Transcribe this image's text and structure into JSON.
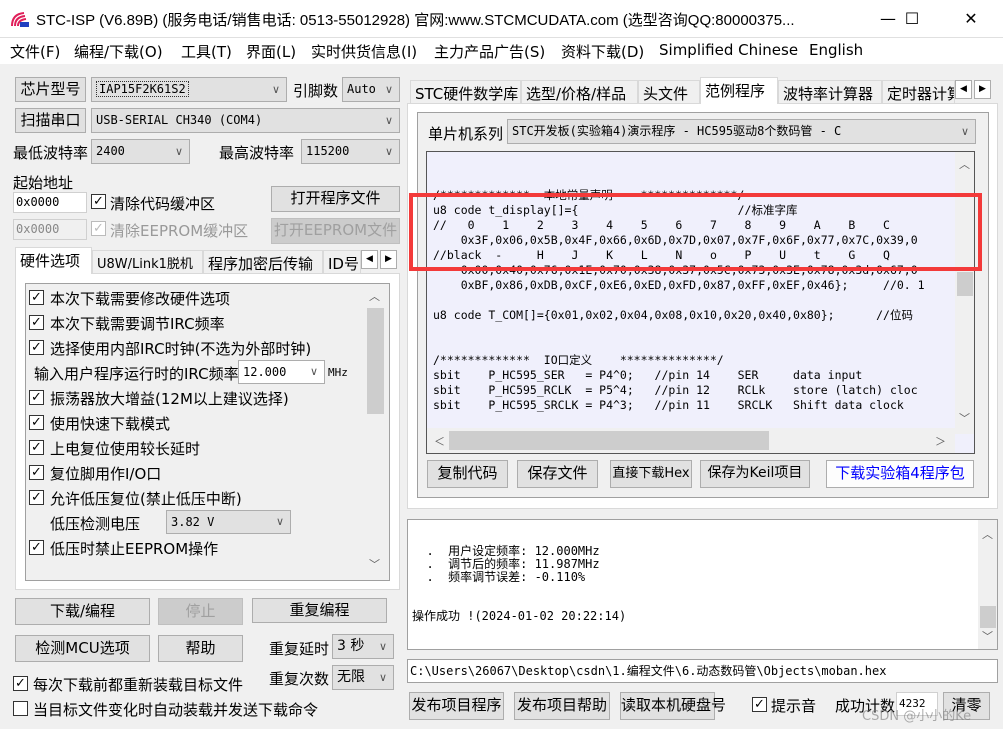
{
  "window": {
    "title": "STC-ISP (V6.89B) (服务电话/销售电话: 0513-55012928) 官网:www.STCMCUDATA.com  (选型咨询QQ:80000375...",
    "controls": {
      "minimize": "—",
      "maximize": "☐",
      "close": "✕"
    }
  },
  "menu": [
    "文件(F)",
    "编程/下载(O)",
    "工具(T)",
    "界面(L)",
    "实时供货信息(I)",
    "主力产品广告(S)",
    "资料下载(D)",
    "Simplified Chinese",
    "English"
  ],
  "left": {
    "chip_type_button": "芯片型号",
    "chip_type_value": "IAP15F2K61S2",
    "pin_label": "引脚数",
    "pin_value": "Auto",
    "scan_port_button": "扫描串口",
    "port_value": "USB-SERIAL CH340 (COM4)",
    "min_baud_label": "最低波特率",
    "min_baud_value": "2400",
    "max_baud_label": "最高波特率",
    "max_baud_value": "115200",
    "start_addr_label": "起始地址",
    "code_addr": "0x0000",
    "clear_code_label": "清除代码缓冲区",
    "clear_code_checked": true,
    "open_program_button": "打开程序文件",
    "eeprom_addr": "0x0000",
    "clear_eeprom_label": "清除EEPROM缓冲区",
    "clear_eeprom_checked": true,
    "open_eeprom_button": "打开EEPROM文件",
    "tabs": [
      "硬件选项",
      "U8W/Link1脱机",
      "程序加密后传输",
      "ID号"
    ],
    "active_tab": 0,
    "options": [
      {
        "label": "本次下载需要修改硬件选项",
        "checked": true
      },
      {
        "label": "本次下载需要调节IRC频率",
        "checked": true
      },
      {
        "label": "选择使用内部IRC时钟(不选为外部时钟)",
        "checked": true
      }
    ],
    "irc_label": "输入用户程序运行时的IRC频率",
    "irc_value": "12.000",
    "irc_unit": "MHz",
    "options2": [
      {
        "label": "振荡器放大增益(12M以上建议选择)",
        "checked": true
      },
      {
        "label": "使用快速下载模式",
        "checked": true
      },
      {
        "label": "上电复位使用较长延时",
        "checked": true
      },
      {
        "label": "复位脚用作I/O口",
        "checked": true
      },
      {
        "label": "允许低压复位(禁止低压中断)",
        "checked": true
      }
    ],
    "low_voltage_label": "低压检测电压",
    "low_voltage_value": "3.82 V",
    "eeprom_protect": {
      "label": "低压时禁止EEPROM操作",
      "checked": true
    },
    "download_button": "下载/编程",
    "stop_button": "停止",
    "repeat_program_button": "重复编程",
    "detect_mcu_button": "检测MCU选项",
    "help_button": "帮助",
    "repeat_delay_label": "重复延时",
    "repeat_delay_value": "3 秒",
    "repeat_count_label": "重复次数",
    "repeat_count_value": "无限",
    "reload_label": "每次下载前都重新装载目标文件",
    "reload_checked": true,
    "auto_send_label": "当目标文件变化时自动装载并发送下载命令",
    "auto_send_checked": false
  },
  "right": {
    "tabs": [
      "STC硬件数学库",
      "选型/价格/样品",
      "头文件",
      "范例程序",
      "波特率计算器",
      "定时器计算"
    ],
    "active_tab": 3,
    "series_label": "单片机系列",
    "series_value": "STC开发板(实验箱4)演示程序 - HC595驱动8个数码管 - C",
    "code_lines": [
      "",
      "",
      "/*************  本地常量声明    **************/",
      "u8 code t_display[]={                       //标准字库",
      "//   0    1    2    3    4    5    6    7    8    9    A    B    C",
      "    0x3F,0x06,0x5B,0x4F,0x66,0x6D,0x7D,0x07,0x7F,0x6F,0x77,0x7C,0x39,0",
      "//black  -     H    J    K    L    N    o    P    U    t    G    Q",
      "    0x00,0x40,0x76,0x1E,0x70,0x38,0x37,0x5C,0x73,0x3E,0x78,0x3d,0x67,0",
      "    0xBF,0x86,0xDB,0xCF,0xE6,0xED,0xFD,0x87,0xFF,0xEF,0x46};     //0. 1",
      "",
      "u8 code T_COM[]={0x01,0x02,0x04,0x08,0x10,0x20,0x40,0x80};      //位码",
      "",
      "",
      "/*************  IO口定义    **************/",
      "sbit    P_HC595_SER   = P4^0;   //pin 14    SER     data input",
      "sbit    P_HC595_RCLK  = P5^4;   //pin 12    RCLk    store (latch) cloc",
      "sbit    P_HC595_SRCLK = P4^3;   //pin 11    SRCLK   Shift data clock"
    ],
    "copy_code_button": "复制代码",
    "save_file_button": "保存文件",
    "direct_download_button": "直接下载Hex",
    "save_keil_button": "保存为Keil项目",
    "download_package_button": "下载实验箱4程序包",
    "log_lines": [
      "",
      "  .  用户设定频率: 12.000MHz",
      "  .  调节后的频率: 11.987MHz",
      "  .  频率调节误差: -0.110%",
      "",
      "",
      "操作成功 !(2024-01-02 20:22:14)"
    ],
    "file_path": "C:\\Users\\26067\\Desktop\\csdn\\1.编程文件\\6.动态数码管\\Objects\\moban.hex",
    "publish_program_button": "发布项目程序",
    "publish_help_button": "发布项目帮助",
    "read_disk_button": "读取本机硬盘号",
    "sound_label": "提示音",
    "sound_checked": true,
    "success_count_label": "成功计数",
    "success_count_value": "4232",
    "clear_button": "清零",
    "watermark": "CSDN @小小的Ke"
  },
  "colors": {
    "highlight": "#f33a3a",
    "link": "#0000ff",
    "code_bg": "#f0f0fc"
  }
}
